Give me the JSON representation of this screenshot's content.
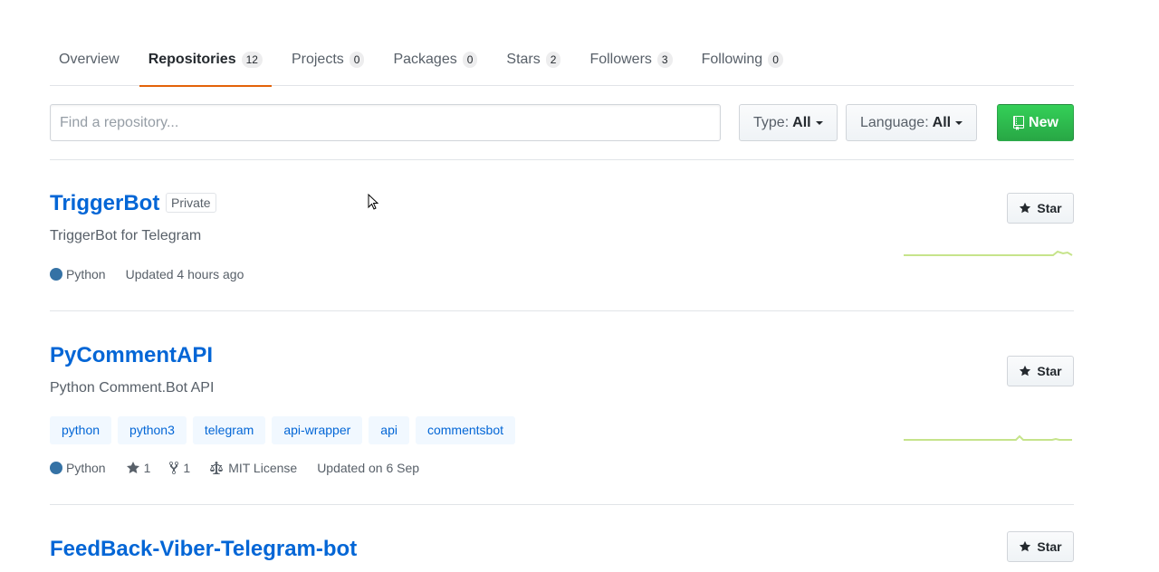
{
  "tabs": [
    {
      "label": "Overview",
      "count": null
    },
    {
      "label": "Repositories",
      "count": "12"
    },
    {
      "label": "Projects",
      "count": "0"
    },
    {
      "label": "Packages",
      "count": "0"
    },
    {
      "label": "Stars",
      "count": "2"
    },
    {
      "label": "Followers",
      "count": "3"
    },
    {
      "label": "Following",
      "count": "0"
    }
  ],
  "selected_tab": "Repositories",
  "filter": {
    "search_placeholder": "Find a repository...",
    "type_label": "Type:",
    "type_value": "All",
    "language_label": "Language:",
    "language_value": "All",
    "new_button": "New"
  },
  "colors": {
    "accent_tab": "#e36209",
    "link": "#0366d6",
    "new_button": "#2ea44f",
    "python": "#3572A5",
    "sparkline": "#c6e48b"
  },
  "repos": [
    {
      "name": "TriggerBot",
      "badge": "Private",
      "description": "TriggerBot for Telegram",
      "language": "Python",
      "updated": "Updated 4 hours ago",
      "star_label": "Star"
    },
    {
      "name": "PyCommentAPI",
      "description": "Python Comment.Bot API",
      "topics": [
        "python",
        "python3",
        "telegram",
        "api-wrapper",
        "api",
        "commentsbot"
      ],
      "language": "Python",
      "stars": "1",
      "forks": "1",
      "license": "MIT License",
      "updated": "Updated on 6 Sep",
      "star_label": "Star"
    },
    {
      "name": "FeedBack-Viber-Telegram-bot",
      "star_label": "Star"
    }
  ]
}
